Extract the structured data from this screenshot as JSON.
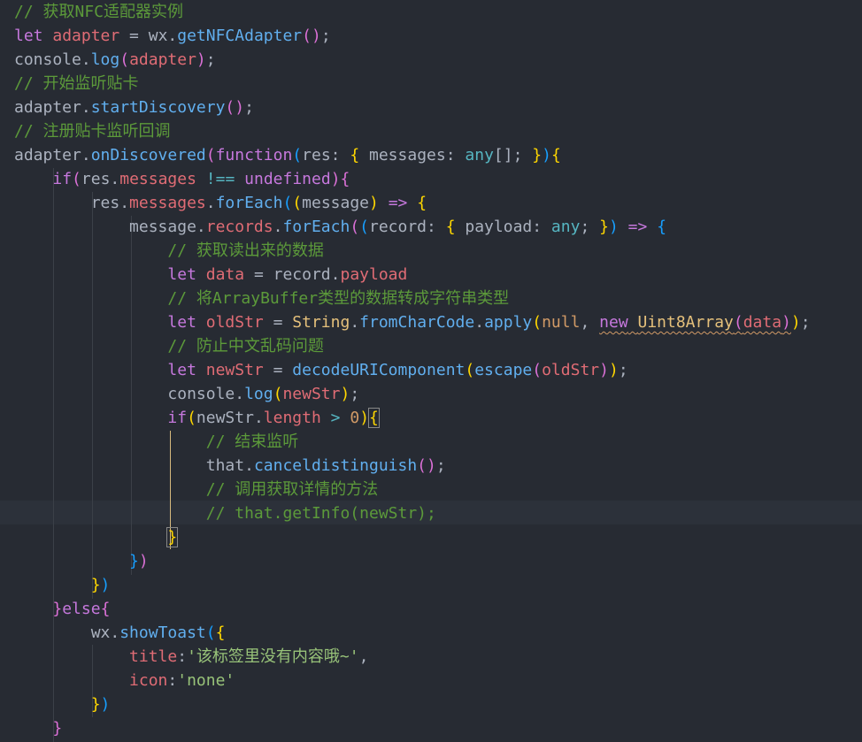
{
  "code_lines": [
    {
      "parts": [
        {
          "c": "cm",
          "t": "// 获取NFC适配器实例"
        }
      ]
    },
    {
      "parts": [
        {
          "c": "kw",
          "t": "let"
        },
        {
          "c": "plain",
          "t": " "
        },
        {
          "c": "var",
          "t": "adapter"
        },
        {
          "c": "plain",
          "t": " = wx."
        },
        {
          "c": "fn",
          "t": "getNFCAdapter"
        },
        {
          "c": "br2",
          "t": "()"
        },
        {
          "c": "plain",
          "t": ";"
        }
      ]
    },
    {
      "parts": [
        {
          "c": "plain",
          "t": "console."
        },
        {
          "c": "fn",
          "t": "log"
        },
        {
          "c": "br2",
          "t": "("
        },
        {
          "c": "var",
          "t": "adapter"
        },
        {
          "c": "br2",
          "t": ")"
        },
        {
          "c": "plain",
          "t": ";"
        }
      ]
    },
    {
      "parts": [
        {
          "c": "cm",
          "t": "// 开始监听贴卡"
        }
      ]
    },
    {
      "parts": [
        {
          "c": "plain",
          "t": "adapter."
        },
        {
          "c": "fn",
          "t": "startDiscovery"
        },
        {
          "c": "br2",
          "t": "()"
        },
        {
          "c": "plain",
          "t": ";"
        }
      ]
    },
    {
      "parts": [
        {
          "c": "cm",
          "t": "// 注册贴卡监听回调"
        }
      ]
    },
    {
      "parts": [
        {
          "c": "plain",
          "t": "adapter."
        },
        {
          "c": "fn",
          "t": "onDiscovered"
        },
        {
          "c": "br2",
          "t": "("
        },
        {
          "c": "kw",
          "t": "function"
        },
        {
          "c": "br3",
          "t": "("
        },
        {
          "c": "plain",
          "t": "res: "
        },
        {
          "c": "br1",
          "t": "{"
        },
        {
          "c": "plain",
          "t": " messages: "
        },
        {
          "c": "op",
          "t": "any"
        },
        {
          "c": "plain",
          "t": "[]; "
        },
        {
          "c": "br1",
          "t": "}"
        },
        {
          "c": "br3",
          "t": ")"
        },
        {
          "c": "br1",
          "t": "{"
        }
      ]
    },
    {
      "parts": [
        {
          "c": "plain",
          "t": "    "
        },
        {
          "c": "kw",
          "t": "if"
        },
        {
          "c": "br2",
          "t": "("
        },
        {
          "c": "plain",
          "t": "res."
        },
        {
          "c": "var",
          "t": "messages"
        },
        {
          "c": "plain",
          "t": " "
        },
        {
          "c": "op",
          "t": "!=="
        },
        {
          "c": "plain",
          "t": " "
        },
        {
          "c": "kw",
          "t": "undefined"
        },
        {
          "c": "br2",
          "t": ")"
        },
        {
          "c": "br2",
          "t": "{"
        }
      ]
    },
    {
      "parts": [
        {
          "c": "plain",
          "t": "        res."
        },
        {
          "c": "var",
          "t": "messages"
        },
        {
          "c": "plain",
          "t": "."
        },
        {
          "c": "fn",
          "t": "forEach"
        },
        {
          "c": "br3",
          "t": "("
        },
        {
          "c": "br1",
          "t": "("
        },
        {
          "c": "plain",
          "t": "message"
        },
        {
          "c": "br1",
          "t": ")"
        },
        {
          "c": "plain",
          "t": " "
        },
        {
          "c": "kw",
          "t": "=>"
        },
        {
          "c": "plain",
          "t": " "
        },
        {
          "c": "br1",
          "t": "{"
        }
      ]
    },
    {
      "parts": [
        {
          "c": "plain",
          "t": "            message."
        },
        {
          "c": "var",
          "t": "records"
        },
        {
          "c": "plain",
          "t": "."
        },
        {
          "c": "fn",
          "t": "forEach"
        },
        {
          "c": "br2",
          "t": "("
        },
        {
          "c": "br3",
          "t": "("
        },
        {
          "c": "plain",
          "t": "record: "
        },
        {
          "c": "br1",
          "t": "{"
        },
        {
          "c": "plain",
          "t": " payload: "
        },
        {
          "c": "op",
          "t": "any"
        },
        {
          "c": "plain",
          "t": "; "
        },
        {
          "c": "br1",
          "t": "}"
        },
        {
          "c": "br3",
          "t": ")"
        },
        {
          "c": "plain",
          "t": " "
        },
        {
          "c": "kw",
          "t": "=>"
        },
        {
          "c": "plain",
          "t": " "
        },
        {
          "c": "br3",
          "t": "{"
        }
      ]
    },
    {
      "parts": [
        {
          "c": "plain",
          "t": "                "
        },
        {
          "c": "cm",
          "t": "// 获取读出来的数据"
        }
      ]
    },
    {
      "parts": [
        {
          "c": "plain",
          "t": "                "
        },
        {
          "c": "kw",
          "t": "let"
        },
        {
          "c": "plain",
          "t": " "
        },
        {
          "c": "var",
          "t": "data"
        },
        {
          "c": "plain",
          "t": " = record."
        },
        {
          "c": "var",
          "t": "payload"
        }
      ]
    },
    {
      "parts": [
        {
          "c": "plain",
          "t": "                "
        },
        {
          "c": "cm",
          "t": "// 将ArrayBuffer类型的数据转成字符串类型"
        }
      ]
    },
    {
      "parts": [
        {
          "c": "plain",
          "t": "                "
        },
        {
          "c": "kw",
          "t": "let"
        },
        {
          "c": "plain",
          "t": " "
        },
        {
          "c": "var",
          "t": "oldStr"
        },
        {
          "c": "plain",
          "t": " = "
        },
        {
          "c": "type",
          "t": "String"
        },
        {
          "c": "plain",
          "t": "."
        },
        {
          "c": "fn",
          "t": "fromCharCode"
        },
        {
          "c": "plain",
          "t": "."
        },
        {
          "c": "fn",
          "t": "apply"
        },
        {
          "c": "br1",
          "t": "("
        },
        {
          "c": "num",
          "t": "null"
        },
        {
          "c": "plain",
          "t": ", "
        },
        {
          "c": "kw squig",
          "t": "new"
        },
        {
          "c": "plain squig",
          "t": " "
        },
        {
          "c": "type squig",
          "t": "Uint8Array"
        },
        {
          "c": "br2 squig",
          "t": "("
        },
        {
          "c": "var squig",
          "t": "data"
        },
        {
          "c": "br2 squig",
          "t": ")"
        },
        {
          "c": "br1",
          "t": ")"
        },
        {
          "c": "plain",
          "t": ";"
        }
      ]
    },
    {
      "parts": [
        {
          "c": "plain",
          "t": "                "
        },
        {
          "c": "cm",
          "t": "// 防止中文乱码问题"
        }
      ]
    },
    {
      "parts": [
        {
          "c": "plain",
          "t": "                "
        },
        {
          "c": "kw",
          "t": "let"
        },
        {
          "c": "plain",
          "t": " "
        },
        {
          "c": "var",
          "t": "newStr"
        },
        {
          "c": "plain",
          "t": " = "
        },
        {
          "c": "fn",
          "t": "decodeURIComponent"
        },
        {
          "c": "br1",
          "t": "("
        },
        {
          "c": "fn",
          "t": "escape"
        },
        {
          "c": "br2",
          "t": "("
        },
        {
          "c": "var",
          "t": "oldStr"
        },
        {
          "c": "br2",
          "t": ")"
        },
        {
          "c": "br1",
          "t": ")"
        },
        {
          "c": "plain",
          "t": ";"
        }
      ]
    },
    {
      "parts": [
        {
          "c": "plain",
          "t": "                console."
        },
        {
          "c": "fn",
          "t": "log"
        },
        {
          "c": "br1",
          "t": "("
        },
        {
          "c": "var",
          "t": "newStr"
        },
        {
          "c": "br1",
          "t": ")"
        },
        {
          "c": "plain",
          "t": ";"
        }
      ]
    },
    {
      "parts": [
        {
          "c": "plain",
          "t": "                "
        },
        {
          "c": "kw",
          "t": "if"
        },
        {
          "c": "br1",
          "t": "("
        },
        {
          "c": "plain",
          "t": "newStr."
        },
        {
          "c": "var",
          "t": "length"
        },
        {
          "c": "plain",
          "t": " "
        },
        {
          "c": "op",
          "t": ">"
        },
        {
          "c": "plain",
          "t": " "
        },
        {
          "c": "num",
          "t": "0"
        },
        {
          "c": "br1",
          "t": ")"
        },
        {
          "c": "br1 box-bracket",
          "t": "{"
        }
      ]
    },
    {
      "parts": [
        {
          "c": "plain",
          "t": "                    "
        },
        {
          "c": "cm",
          "t": "// 结束监听"
        }
      ]
    },
    {
      "parts": [
        {
          "c": "plain",
          "t": "                    that."
        },
        {
          "c": "fn",
          "t": "canceldistinguish"
        },
        {
          "c": "br2",
          "t": "()"
        },
        {
          "c": "plain",
          "t": ";"
        }
      ]
    },
    {
      "parts": [
        {
          "c": "plain",
          "t": "                    "
        },
        {
          "c": "cm",
          "t": "// 调用获取详情的方法"
        }
      ]
    },
    {
      "parts": [
        {
          "c": "plain",
          "t": "                    "
        },
        {
          "c": "cm",
          "t": "// that.getInfo(newStr);"
        }
      ]
    },
    {
      "parts": [
        {
          "c": "plain",
          "t": "                "
        },
        {
          "c": "br1 box-bracket",
          "t": "}"
        }
      ]
    },
    {
      "parts": [
        {
          "c": "plain",
          "t": "            "
        },
        {
          "c": "br3",
          "t": "}"
        },
        {
          "c": "br2",
          "t": ")"
        }
      ]
    },
    {
      "parts": [
        {
          "c": "plain",
          "t": "        "
        },
        {
          "c": "br1",
          "t": "}"
        },
        {
          "c": "br3",
          "t": ")"
        }
      ]
    },
    {
      "parts": [
        {
          "c": "plain",
          "t": "    "
        },
        {
          "c": "br2",
          "t": "}"
        },
        {
          "c": "kw",
          "t": "else"
        },
        {
          "c": "br2",
          "t": "{"
        }
      ]
    },
    {
      "parts": [
        {
          "c": "plain",
          "t": "        wx."
        },
        {
          "c": "fn",
          "t": "showToast"
        },
        {
          "c": "br3",
          "t": "("
        },
        {
          "c": "br1",
          "t": "{"
        }
      ]
    },
    {
      "parts": [
        {
          "c": "plain",
          "t": "            "
        },
        {
          "c": "var",
          "t": "title"
        },
        {
          "c": "plain",
          "t": ":"
        },
        {
          "c": "str",
          "t": "'该标签里没有内容哦~'"
        },
        {
          "c": "plain",
          "t": ","
        }
      ]
    },
    {
      "parts": [
        {
          "c": "plain",
          "t": "            "
        },
        {
          "c": "var",
          "t": "icon"
        },
        {
          "c": "plain",
          "t": ":"
        },
        {
          "c": "str",
          "t": "'none'"
        }
      ]
    },
    {
      "parts": [
        {
          "c": "plain",
          "t": "        "
        },
        {
          "c": "br1",
          "t": "}"
        },
        {
          "c": "br3",
          "t": ")"
        }
      ]
    },
    {
      "parts": [
        {
          "c": "plain",
          "t": "    "
        },
        {
          "c": "br2",
          "t": "}"
        }
      ]
    }
  ],
  "highlighted_line": 21
}
